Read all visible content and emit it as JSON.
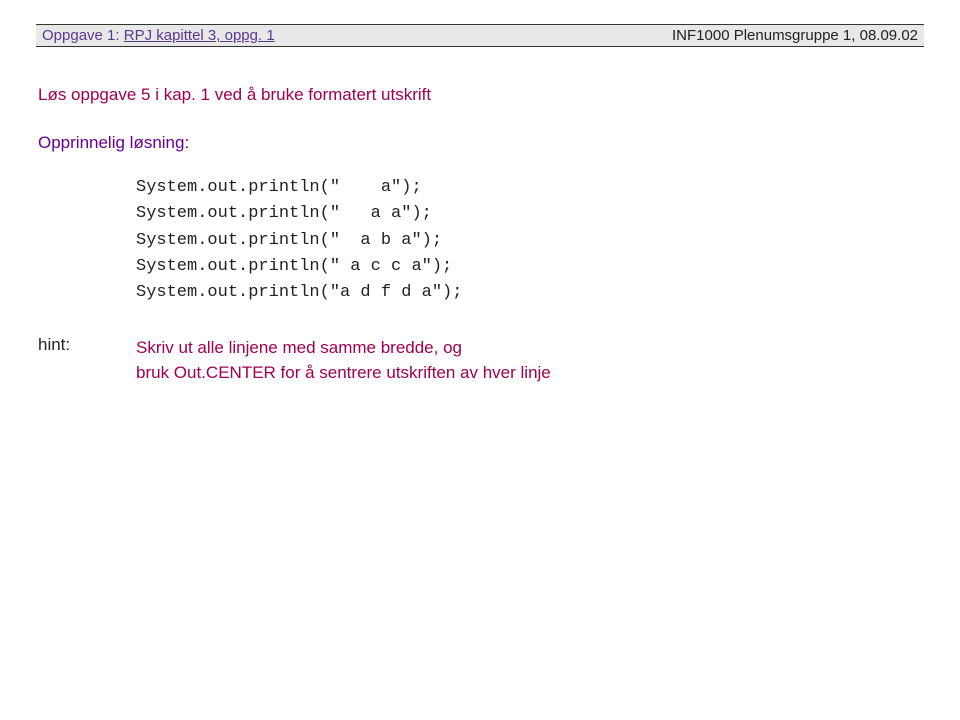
{
  "header": {
    "left_prefix": "Oppgave 1: ",
    "left_underlined": "RPJ kapittel 3, oppg. 1",
    "right": "INF1000  Plenumsgruppe 1, 08.09.02"
  },
  "title": "Løs oppgave 5 i kap. 1 ved å bruke formatert utskrift",
  "section_label": "Opprinnelig løsning:",
  "code": {
    "line1": "System.out.println(\"    a\");",
    "line2": "System.out.println(\"   a a\");",
    "line3": "System.out.println(\"  a b a\");",
    "line4": "System.out.println(\" a c c a\");",
    "line5": "System.out.println(\"a d f d a\");"
  },
  "hint": {
    "label": "hint:",
    "text1": "Skriv ut alle linjene med samme bredde, og",
    "text2": "bruk Out.CENTER for å sentrere utskriften av hver linje"
  }
}
